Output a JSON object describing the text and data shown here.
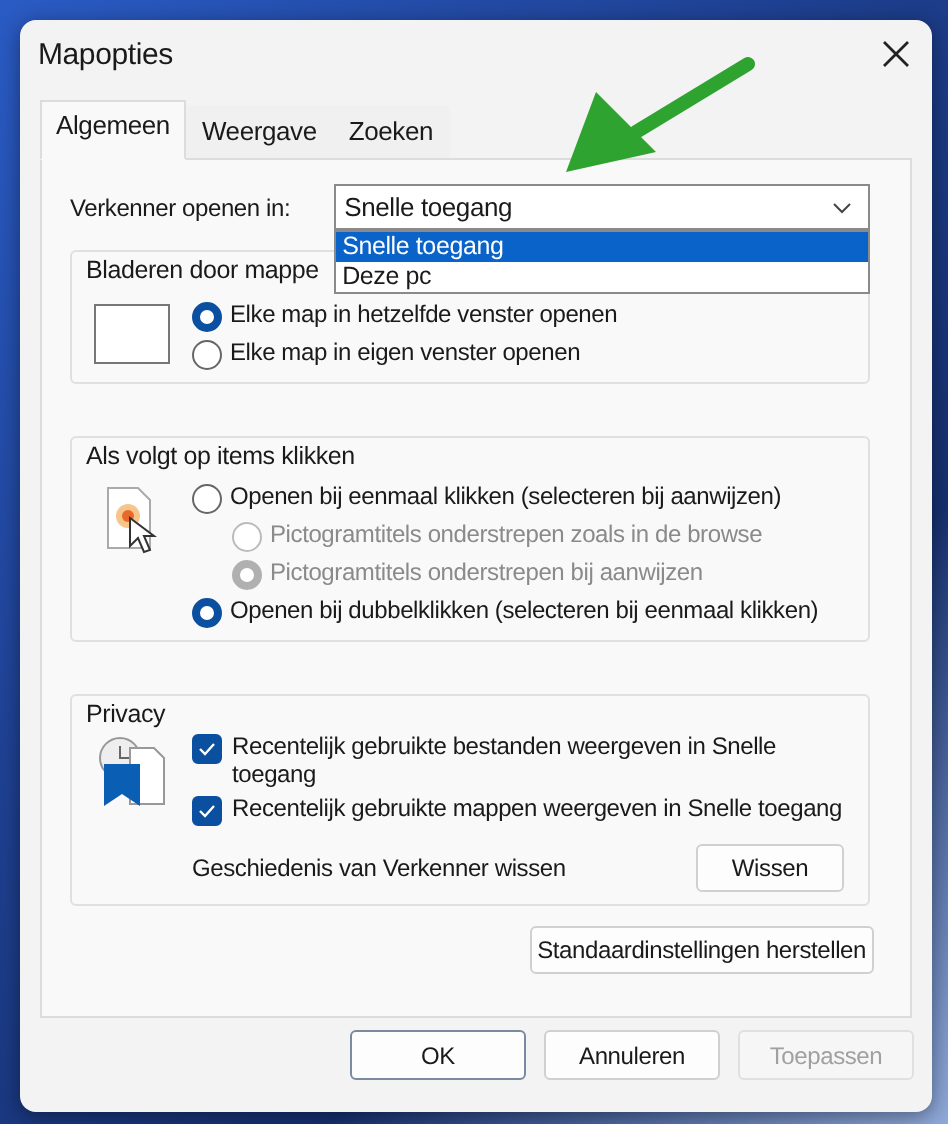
{
  "window": {
    "title": "Mapopties"
  },
  "tabs": [
    {
      "label": "Algemeen",
      "selected": true
    },
    {
      "label": "Weergave",
      "selected": false
    },
    {
      "label": "Zoeken",
      "selected": false
    }
  ],
  "open_in": {
    "label": "Verkenner openen in:",
    "value": "Snelle toegang",
    "expanded": true,
    "options": [
      {
        "label": "Snelle toegang",
        "selected": true
      },
      {
        "label": "Deze pc",
        "selected": false
      }
    ]
  },
  "browse_group": {
    "title": "Bladeren door mappe",
    "options": [
      {
        "label": "Elke map in hetzelfde venster openen",
        "selected": true
      },
      {
        "label": "Elke map in eigen venster openen",
        "selected": false
      }
    ]
  },
  "click_group": {
    "title": "Als volgt op items klikken",
    "options": [
      {
        "label": "Openen bij eenmaal klikken (selecteren bij aanwijzen)",
        "selected": false,
        "disabled": false,
        "children": [
          {
            "label": "Pictogramtitels onderstrepen zoals in de browse",
            "selected": false,
            "disabled": true
          },
          {
            "label": "Pictogramtitels onderstrepen bij aanwijzen",
            "selected": true,
            "disabled": true
          }
        ]
      },
      {
        "label": "Openen bij dubbelklikken (selecteren bij eenmaal klikken)",
        "selected": true,
        "disabled": false
      }
    ]
  },
  "privacy_group": {
    "title": "Privacy",
    "checkboxes": [
      {
        "label": "Recentelijk gebruikte bestanden weergeven in Snelle toegang",
        "checked": true
      },
      {
        "label": "Recentelijk gebruikte mappen weergeven in Snelle toegang",
        "checked": true
      }
    ],
    "clear_label": "Geschiedenis van Verkenner wissen",
    "clear_button": "Wissen"
  },
  "restore_button": "Standaardinstellingen herstellen",
  "buttons": [
    {
      "label": "OK",
      "default": true,
      "disabled": false
    },
    {
      "label": "Annuleren",
      "default": false,
      "disabled": false
    },
    {
      "label": "Toepassen",
      "default": false,
      "disabled": true
    }
  ]
}
